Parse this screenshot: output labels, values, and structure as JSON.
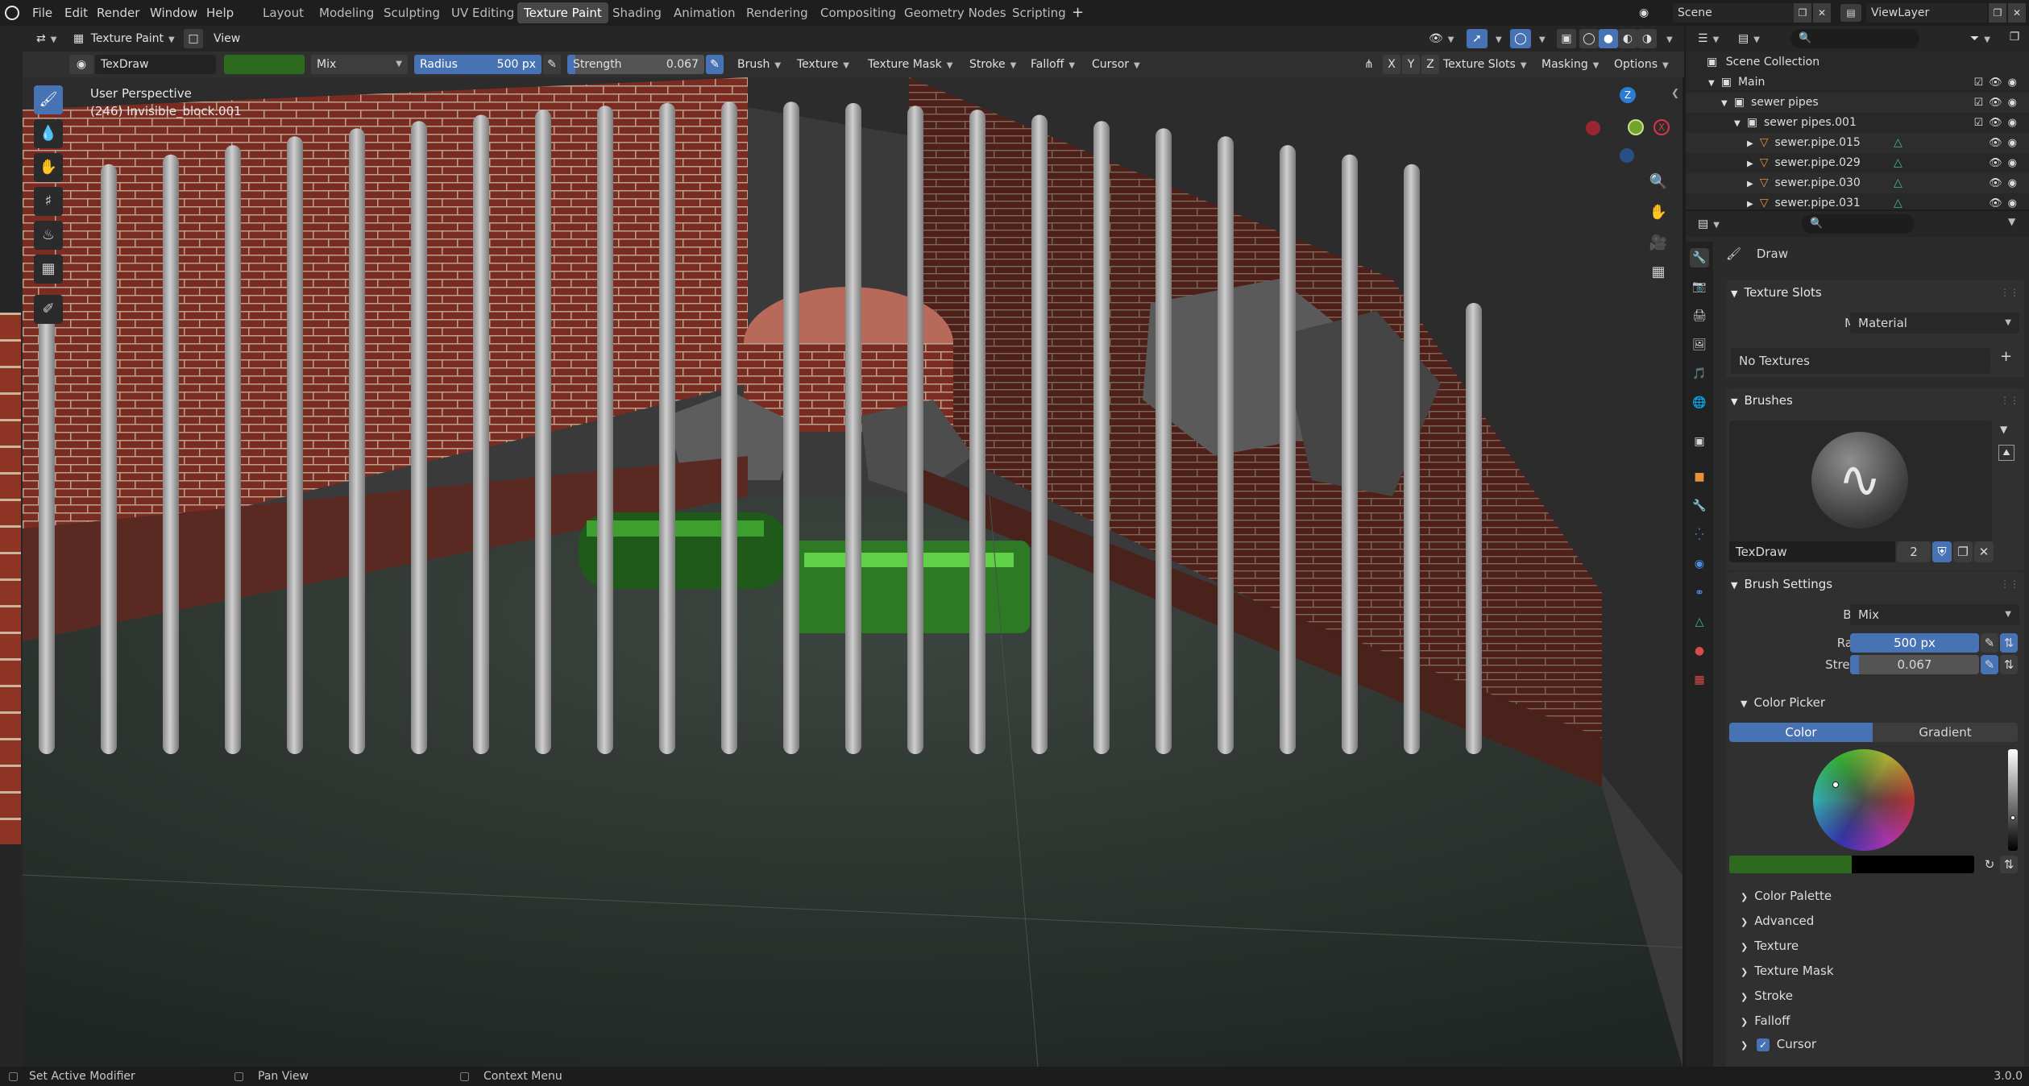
{
  "menu": {
    "items": [
      "File",
      "Edit",
      "Render",
      "Window",
      "Help"
    ],
    "workspaces": [
      "Layout",
      "Modeling",
      "Sculpting",
      "UV Editing",
      "Texture Paint",
      "Shading",
      "Animation",
      "Rendering",
      "Compositing",
      "Geometry Nodes",
      "Scripting"
    ],
    "active_workspace": "Texture Paint",
    "add_tab": "+",
    "scene_value": "Scene",
    "viewlayer_value": "ViewLayer"
  },
  "editor_header": {
    "mode": "Texture Paint",
    "view": "View",
    "brush_name": "TexDraw",
    "blend": "Mix",
    "radius_label": "Radius",
    "radius_value": "500 px",
    "strength_label": "Strength",
    "strength_value": "0.067",
    "dropdowns": [
      "Brush",
      "Texture",
      "Texture Mask",
      "Stroke",
      "Falloff",
      "Cursor"
    ],
    "axes": [
      "X",
      "Y",
      "Z"
    ],
    "right_dropdowns": [
      "Texture Slots",
      "Masking",
      "Options"
    ],
    "color_swatch": "#2d6a1f"
  },
  "viewport": {
    "perspective": "User Perspective",
    "object": "(246) Invisible_block.001",
    "gizmo": {
      "z": "Z",
      "x": "X",
      "y": "Y"
    }
  },
  "outliner": {
    "root": "Scene Collection",
    "rows": [
      {
        "label": "Main",
        "indent": 0
      },
      {
        "label": "sewer pipes",
        "indent": 1
      },
      {
        "label": "sewer pipes.001",
        "indent": 2
      },
      {
        "label": "sewer.pipe.015",
        "indent": 3
      },
      {
        "label": "sewer.pipe.029",
        "indent": 3
      },
      {
        "label": "sewer.pipe.030",
        "indent": 3
      },
      {
        "label": "sewer.pipe.031",
        "indent": 3
      }
    ]
  },
  "properties": {
    "context": "Draw",
    "texture_slots": {
      "title": "Texture Slots",
      "mode_label": "Mode",
      "mode_value": "Material",
      "empty": "No Textures"
    },
    "brushes": {
      "title": "Brushes",
      "name": "TexDraw",
      "users": "2"
    },
    "brush_settings": {
      "title": "Brush Settings",
      "blend_label": "Blend",
      "blend_value": "Mix",
      "radius_label": "Radius",
      "radius_value": "500 px",
      "strength_label": "Strength",
      "strength_value": "0.067"
    },
    "color_picker": {
      "title": "Color Picker",
      "tab_color": "Color",
      "tab_gradient": "Gradient",
      "color_hex": "#2d6a1f"
    },
    "collapsed": [
      "Color Palette",
      "Advanced",
      "Texture",
      "Texture Mask",
      "Stroke",
      "Falloff"
    ],
    "cursor_label": "Cursor"
  },
  "status": {
    "left": "Set Active Modifier",
    "middle": "Pan View",
    "right": "Context Menu",
    "version": "3.0.0"
  },
  "colors": {
    "accent": "#4772b3",
    "brush_color": "#2d6a1f"
  }
}
